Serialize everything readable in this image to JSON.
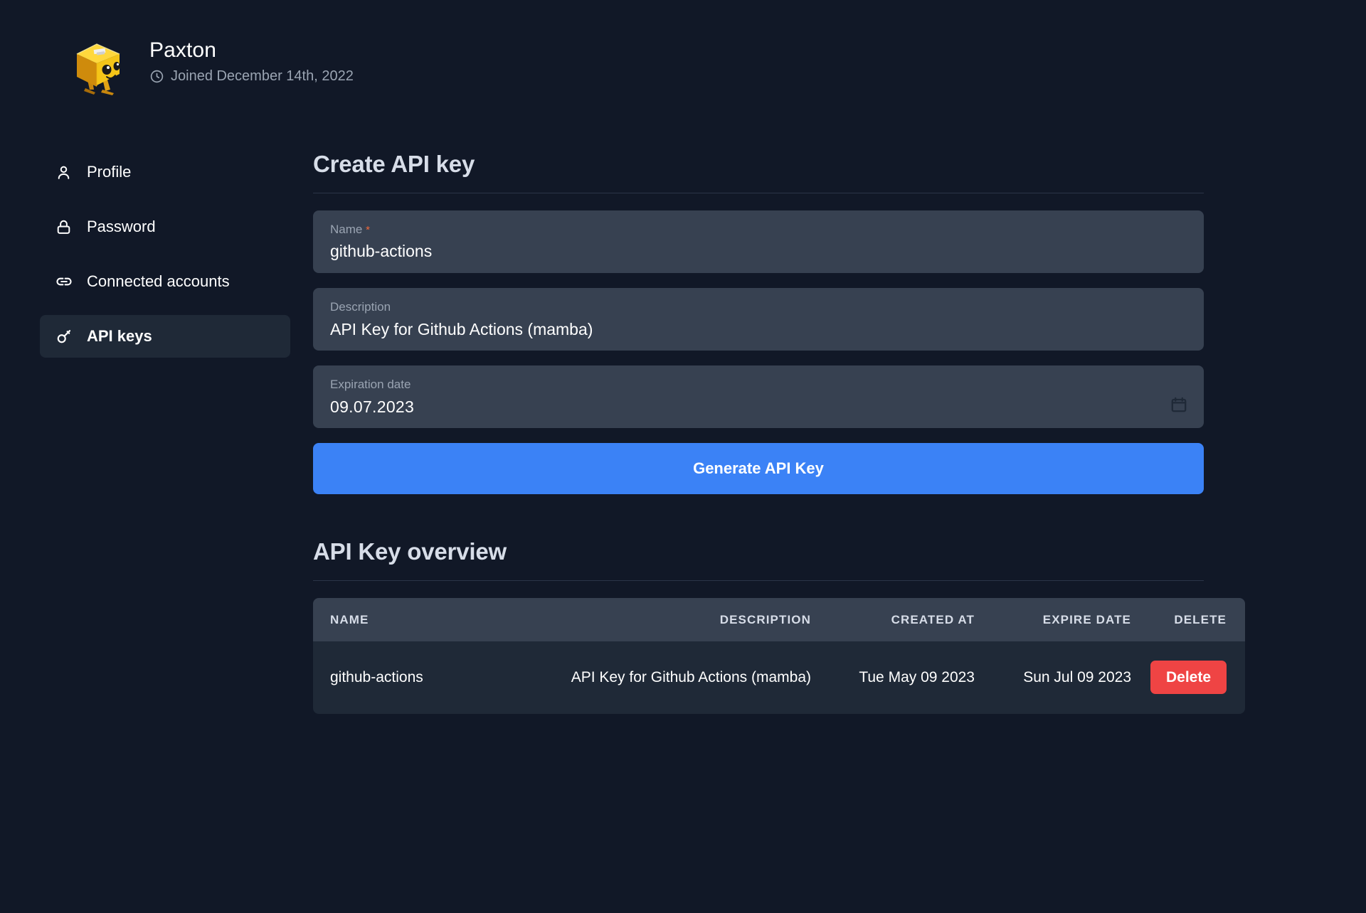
{
  "profile": {
    "name": "Paxton",
    "joined_text": "Joined December 14th, 2022",
    "clock_icon": "clock-icon",
    "avatar_icon": "robot-cube-avatar"
  },
  "sidebar": {
    "items": [
      {
        "label": "Profile",
        "icon": "user-icon",
        "active": false
      },
      {
        "label": "Password",
        "icon": "lock-icon",
        "active": false
      },
      {
        "label": "Connected accounts",
        "icon": "link-icon",
        "active": false
      },
      {
        "label": "API keys",
        "icon": "key-icon",
        "active": true
      }
    ]
  },
  "create_form": {
    "title": "Create API key",
    "name_label": "Name",
    "name_required_mark": "*",
    "name_value": "github-actions",
    "name_placeholder": "Name",
    "description_label": "Description",
    "description_value": "API Key for Github Actions (mamba)",
    "description_placeholder": "Description",
    "expiration_label": "Expiration date",
    "expiration_value": "09.07.2023",
    "expiration_placeholder": "dd.mm.yyyy",
    "calendar_icon": "calendar-icon",
    "submit_label": "Generate API Key"
  },
  "overview": {
    "title": "API Key overview",
    "columns": [
      "NAME",
      "DESCRIPTION",
      "CREATED AT",
      "EXPIRE DATE",
      "DELETE"
    ],
    "rows": [
      {
        "name": "github-actions",
        "description": "API Key for Github Actions (mamba)",
        "created_at": "Tue May 09 2023",
        "expire_date": "Sun Jul 09 2023",
        "delete_label": "Delete"
      }
    ]
  },
  "colors": {
    "page_background": "#111827",
    "field_background": "#374151",
    "active_nav_background": "#1f2937",
    "primary_button": "#3b82f6",
    "danger_button": "#ef4444",
    "required_mark": "#f0683a",
    "heading_text": "#d7dde8",
    "muted_text": "#9aa4b2"
  }
}
